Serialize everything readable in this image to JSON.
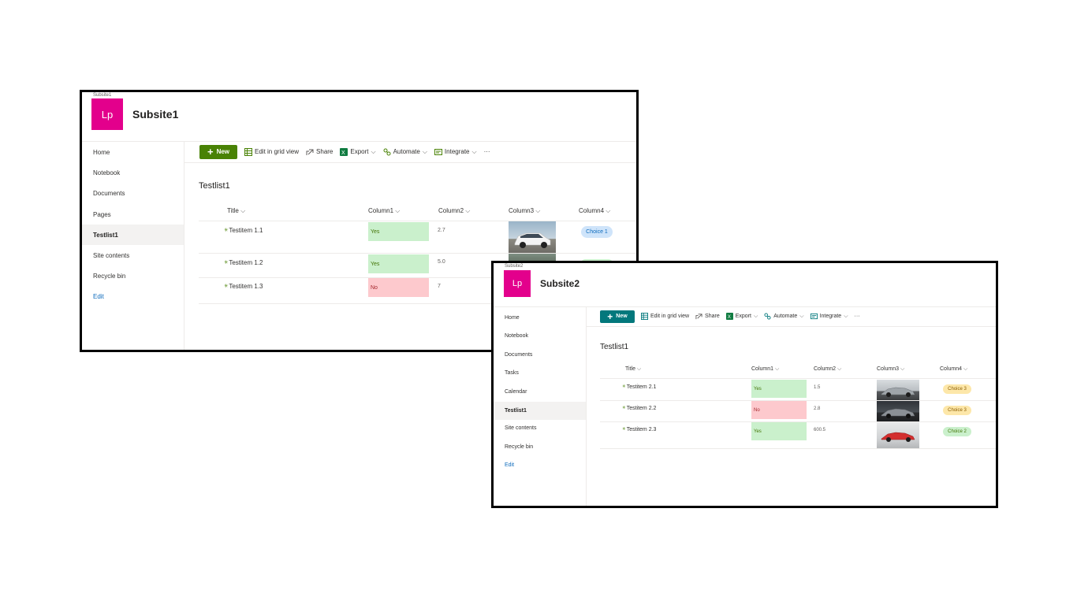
{
  "subsite1": {
    "breadcrumb": "Subsite1",
    "logo": "Lp",
    "title": "Subsite1",
    "nav": [
      "Home",
      "Notebook",
      "Documents",
      "Pages",
      "Testlist1",
      "Site contents",
      "Recycle bin",
      "Edit"
    ],
    "active_nav": "Testlist1",
    "toolbar": {
      "new": "New",
      "edit_grid": "Edit in grid view",
      "share": "Share",
      "export": "Export",
      "automate": "Automate",
      "integrate": "Integrate",
      "more": "···"
    },
    "list_title": "Testlist1",
    "columns": [
      "Title",
      "Column1",
      "Column2",
      "Column3",
      "Column4"
    ],
    "rows": [
      {
        "title": "Testitem 1.1",
        "column1": "Yes",
        "column2": "2.7",
        "column3": "white hatchback car photo",
        "column4": "Choice 1"
      },
      {
        "title": "Testitem 1.2",
        "column1": "Yes",
        "column2": "5.0",
        "column3": "car photo",
        "column4": ""
      },
      {
        "title": "Testitem 1.3",
        "column1": "No",
        "column2": "7",
        "column3": "",
        "column4": ""
      }
    ]
  },
  "subsite2": {
    "breadcrumb": "Subsite2",
    "logo": "Lp",
    "title": "Subsite2",
    "nav": [
      "Home",
      "Notebook",
      "Documents",
      "Tasks",
      "Calendar",
      "Testlist1",
      "Site contents",
      "Recycle bin",
      "Edit"
    ],
    "active_nav": "Testlist1",
    "toolbar": {
      "new": "New",
      "edit_grid": "Edit in grid view",
      "share": "Share",
      "export": "Export",
      "automate": "Automate",
      "integrate": "Integrate",
      "more": "···"
    },
    "list_title": "Testlist1",
    "columns": [
      "Title",
      "Column1",
      "Column2",
      "Column3",
      "Column4"
    ],
    "rows": [
      {
        "title": "Testitem 2.1",
        "column1": "Yes",
        "column2": "1.5",
        "column3": "silver sports car photo",
        "column4": "Choice 3"
      },
      {
        "title": "Testitem 2.2",
        "column1": "No",
        "column2": "2.8",
        "column3": "grey sports car photo",
        "column4": "Choice 3"
      },
      {
        "title": "Testitem 2.3",
        "column1": "Yes",
        "column2": "600.5",
        "column3": "red sports car photo",
        "column4": "Choice 2"
      }
    ]
  },
  "colors": {
    "logo_bg": "#e3008c",
    "new_button_subsite1": "#498205",
    "new_button_subsite2": "#03787c",
    "yes_bg": "#caf0cc",
    "no_bg": "#fdc9cd",
    "choice1_bg": "#cfe4fa",
    "choice2_bg": "#caf0cc",
    "choice3_bg": "#fde7a9"
  }
}
